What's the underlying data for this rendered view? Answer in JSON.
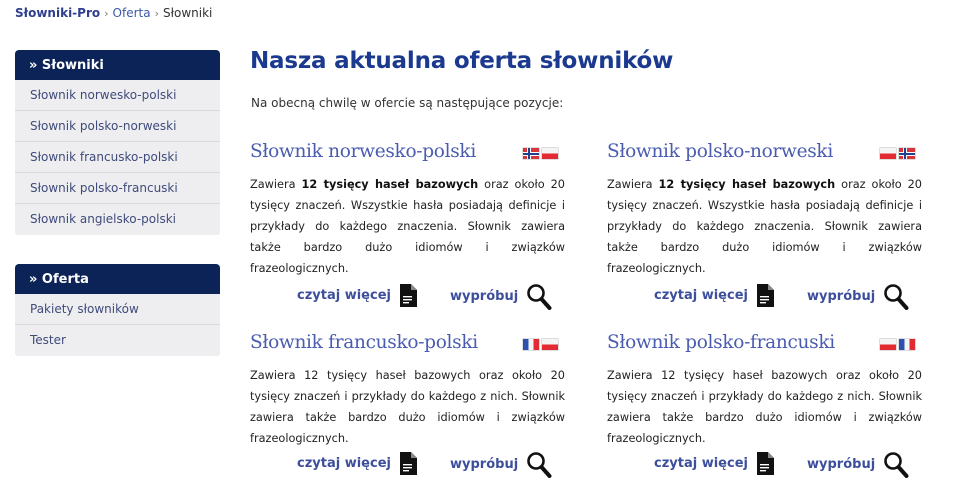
{
  "breadcrumb": {
    "home": "Słowniki-Pro",
    "sep1": "›",
    "offer": "Oferta",
    "sep2": "›",
    "current": "Słowniki"
  },
  "sidebar": {
    "dictionaries": {
      "header": "» Słowniki",
      "items": [
        {
          "label": "Słownik norwesko-polski"
        },
        {
          "label": "Słownik polsko-norweski"
        },
        {
          "label": "Słownik francusko-polski"
        },
        {
          "label": "Słownik polsko-francuski"
        },
        {
          "label": "Słownik angielsko-polski"
        }
      ]
    },
    "offer": {
      "header": "» Oferta",
      "items": [
        {
          "label": "Pakiety słowników"
        },
        {
          "label": "Tester"
        }
      ]
    }
  },
  "main": {
    "title": "Nasza aktualna oferta słowników",
    "intro": "Na obecną chwilę w ofercie są następujące pozycje:",
    "cards": [
      {
        "title": "Słownik norwesko-polski",
        "flags": [
          "flag-norway-icon",
          "flag-poland-icon"
        ],
        "desc_pre": "Zawiera ",
        "desc_bold": "12 tysięcy haseł bazowych",
        "desc_post": " oraz około 20 tysięcy znaczeń. Wszystkie hasła posiadają definicje i przykłady do każdego znaczenia. Słownik zawiera także bardzo dużo idiomów i związków frazeologicznych.",
        "more_label": "czytaj więcej",
        "try_label": "wypróbuj"
      },
      {
        "title": "Słownik polsko-norweski",
        "flags": [
          "flag-poland-icon",
          "flag-norway-icon"
        ],
        "desc_pre": "Zawiera ",
        "desc_bold": "12 tysięcy haseł bazowych",
        "desc_post": " oraz około 20 tysięcy znaczeń. Wszystkie hasła posiadają definicje i przykłady do każdego znaczenia. Słownik zawiera także bardzo dużo idiomów i związków frazeologicznych.",
        "more_label": "czytaj więcej",
        "try_label": "wypróbuj"
      },
      {
        "title": "Słownik francusko-polski",
        "flags": [
          "flag-france-icon",
          "flag-poland-icon"
        ],
        "desc_pre": "",
        "desc_bold": "",
        "desc_post": "Zawiera 12 tysięcy haseł bazowych oraz około 20 tysięcy znaczeń i przykłady do każdego z nich. Słownik zawiera także bardzo dużo idiomów i związków frazeologicznych.",
        "more_label": "czytaj więcej",
        "try_label": "wypróbuj"
      },
      {
        "title": "Słownik polsko-francuski",
        "flags": [
          "flag-poland-icon",
          "flag-france-icon"
        ],
        "desc_pre": "",
        "desc_bold": "",
        "desc_post": "Zawiera 12 tysięcy haseł bazowych oraz około 20 tysięcy znaczeń i przykłady do każdego z nich. Słownik zawiera także bardzo dużo idiomów i związków frazeologicznych.",
        "more_label": "czytaj więcej",
        "try_label": "wypróbuj"
      }
    ]
  },
  "colors": {
    "sidebar_header": "#0c2357",
    "title": "#1b3a8f",
    "card_title": "#4a5cb0",
    "link": "#3d4f9c"
  }
}
